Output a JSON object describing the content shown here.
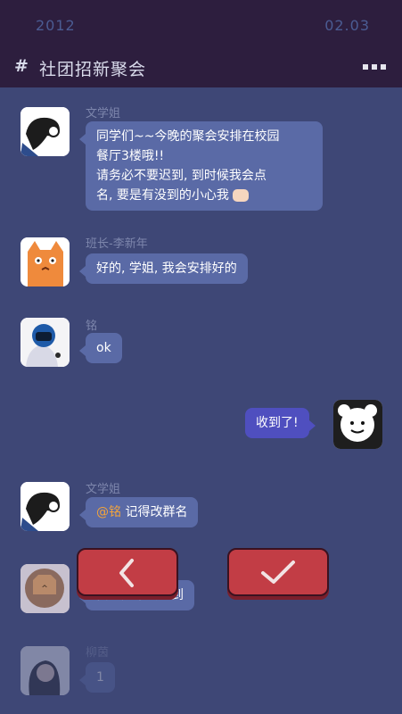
{
  "status": {
    "year": "2012",
    "date": "02.03"
  },
  "header": {
    "hash": "#",
    "title": "社团招新聚会"
  },
  "messages": [
    {
      "sender": "文学姐",
      "lines": [
        "同学们~~今晚的聚会安排在校园",
        "餐厅3楼哦!!",
        "请务必不要迟到, 到时候我会点",
        "名, 要是有没到的小心我"
      ]
    },
    {
      "sender": "班长-李新年",
      "text": "好的, 学姐, 我会安排好的"
    },
    {
      "sender": "铭",
      "text": "ok"
    },
    {
      "text": "收到了!"
    },
    {
      "sender": "文学姐",
      "mention": "@铭",
      "text": " 记得改群名"
    },
    {
      "text": "我肯定不会迟到"
    },
    {
      "sender": "柳茵",
      "text": "1"
    }
  ],
  "colors": {
    "background": "#3e4776",
    "header": "#2d1e3e",
    "bubble": "#5a6aa6",
    "bubble_self": "#4f4fbf",
    "button": "#c23d45"
  },
  "buttons": {
    "back": "chevron-left-icon",
    "confirm": "check-icon"
  }
}
